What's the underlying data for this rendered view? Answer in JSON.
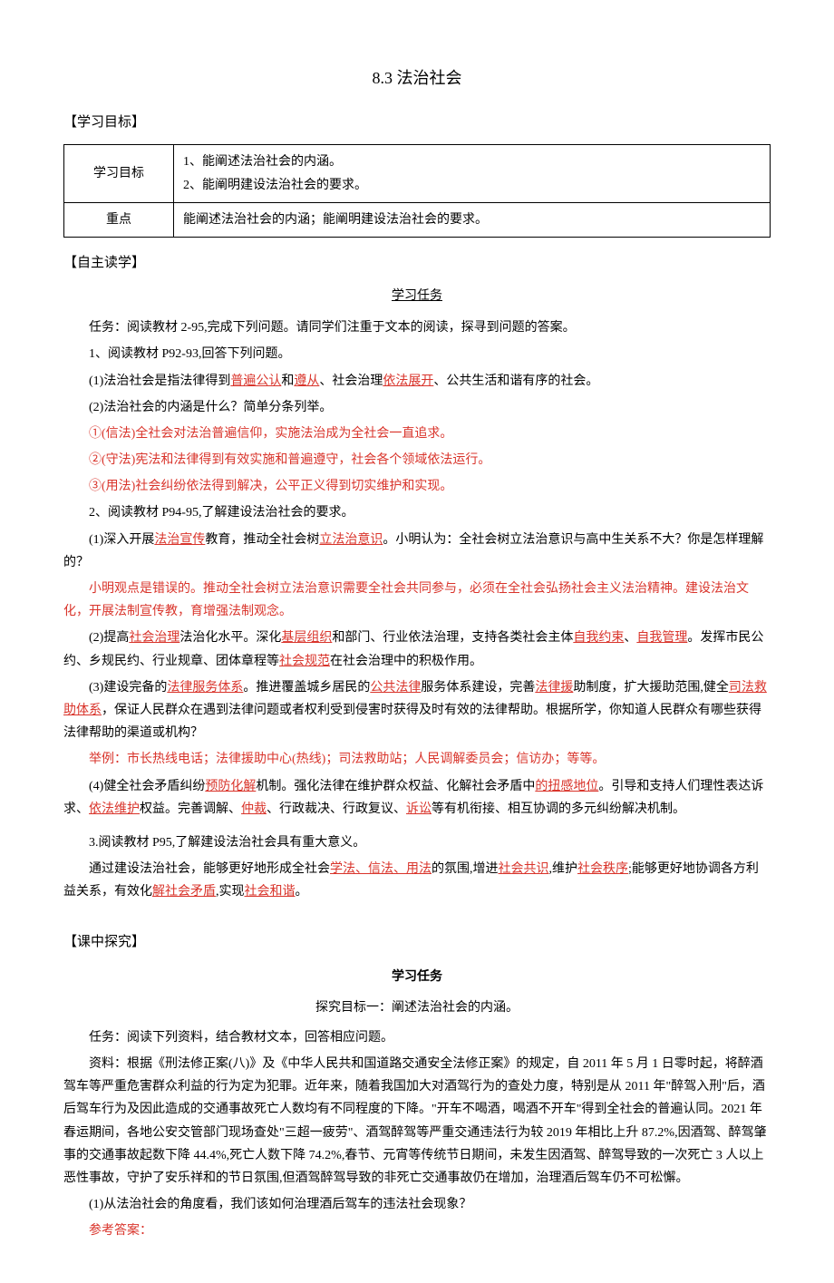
{
  "title": "8.3 法治社会",
  "sections": {
    "goals_heading": "【学习目标】",
    "self_study_heading": "【自主读学】",
    "explore_heading": "【课中探究】"
  },
  "goals_table": {
    "r1c1": "学习目标",
    "r1c2a": "1、能阐述法治社会的内涵。",
    "r1c2b": "2、能阐明建设法治社会的要求。",
    "r2c1": "重点",
    "r2c2": "能阐述法治社会的内涵；能阐明建设法治社会的要求。"
  },
  "study": {
    "task_heading": "学习任务",
    "task_line": "任务：阅读教材 2-95,完成下列问题。请同学们注重于文本的阅读，探寻到问题的答案。",
    "q1_intro": "1、阅读教材 P92-93,回答下列问题。",
    "q1_1_pre": "(1)法治社会是指法律得到",
    "q1_1_u1": "普遍公认",
    "q1_1_mid1": "和",
    "q1_1_u2": "遵从",
    "q1_1_mid2": "、社会治理",
    "q1_1_u3": "依法展开",
    "q1_1_post": "、公共生活和谐有序的社会。",
    "q1_2": "(2)法治社会的内涵是什么？简单分条列举。",
    "ans1": "①(信法)全社会对法治普遍信仰，实施法治成为全社会一直追求。",
    "ans2": "②(守法)宪法和法律得到有效实施和普遍遵守，社会各个领域依法运行。",
    "ans3": "③(用法)社会纠纷依法得到解决，公平正义得到切实维护和实现。",
    "q2_intro": "2、阅读教材 P94-95,了解建设法治社会的要求。",
    "q2_1_pre": "(1)深入开展",
    "q2_1_u1": "法治宣传",
    "q2_1_mid1": "教育，推动全社会树",
    "q2_1_u2": "立法治意识",
    "q2_1_post": "。小明认为：全社会树立法治意识与高中生关系不大？你是怎样理解的？",
    "q2_1_ans": "小明观点是错误的。推动全社会树立法治意识需要全社会共同参与，必须在全社会弘扬社会主义法治精神。建设法治文化，开展法制宣传教，育增强法制观念。",
    "q2_2_pre": "(2)提高",
    "q2_2_u1": "社会治理",
    "q2_2_mid1": "法治化水平。深化",
    "q2_2_u2": "基层组织",
    "q2_2_mid2": "和部门、行业依法治理，支持各类社会主体",
    "q2_2_u3": "自我约束",
    "q2_2_mid3": "、",
    "q2_2_u4": "自我管理",
    "q2_2_mid4": "。发挥市民公约、乡规民约、行业规章、团体章程等",
    "q2_2_u5": "社会规范",
    "q2_2_post": "在社会治理中的积极作用。",
    "q2_3_pre": "(3)建设完备的",
    "q2_3_u1": "法律服务体系",
    "q2_3_mid1": "。推进覆盖城乡居民的",
    "q2_3_u2": "公共法律",
    "q2_3_mid2": "服务体系建设，完善",
    "q2_3_u3": "法律援",
    "q2_3_mid3": "助制度，扩大援助范围,健全",
    "q2_3_u4": "司法救助体系",
    "q2_3_post": "，保证人民群众在遇到法律问题或者权利受到侵害时获得及时有效的法律帮助。根据所学，你知道人民群众有哪些获得法律帮助的渠道或机构？",
    "q2_3_ans": "举例：市长热线电话；法律援助中心(热线)；司法救助站；人民调解委员会；信访办；等等。",
    "q2_4_pre": "(4)健全社会矛盾纠纷",
    "q2_4_u1": "预防化解",
    "q2_4_mid1": "机制。强化法律在维护群众权益、化解社会矛盾中",
    "q2_4_u2": "的扭感地位",
    "q2_4_mid2": "。引导和支持人们理性表达诉求、",
    "q2_4_u3": "依法维护",
    "q2_4_mid3": "权益。完善调解、",
    "q2_4_u4": "仲裁",
    "q2_4_mid4": "、行政裁决、行政复议、",
    "q2_4_u5": "诉讼",
    "q2_4_post": "等有机衔接、相互协调的多元纠纷解决机制。",
    "q3_intro": "3.阅读教材 P95,了解建设法治社会具有重大意义。",
    "q3_pre": "通过建设法治社会，能够更好地形成全社会",
    "q3_u1": "学法、信法、用法",
    "q3_mid1": "的氛围,增进",
    "q3_u2": "社会共识",
    "q3_mid2": ",维护",
    "q3_u3": "社会秩序",
    "q3_mid3": ";能够更好地协调各方利益关系，有效化",
    "q3_u4": "解社会矛盾",
    "q3_mid4": ",实现",
    "q3_u5": "社会和谐",
    "q3_post": "。"
  },
  "explore": {
    "task_heading": "学习任务",
    "target1": "探究目标一：阐述法治社会的内涵。",
    "task_intro": "任务：阅读下列资料，结合教材文本，回答相应问题。",
    "material": "资料：根据《刑法修正案(八)》及《中华人民共和国道路交通安全法修正案》的规定，自 2011 年 5 月 1 日零时起，将醉酒驾车等严重危害群众利益的行为定为犯罪。近年来，随着我国加大对酒驾行为的查处力度，特别是从 2011 年\"醉驾入刑\"后，酒后驾车行为及因此造成的交通事故死亡人数均有不同程度的下降。\"开车不喝酒，喝酒不开车\"得到全社会的普遍认同。2021 年春运期间，各地公安交管部门现场查处\"三超一疲劳\"、酒驾醉驾等严重交通违法行为较 2019 年相比上升 87.2%,因酒驾、醉驾肇事的交通事故起数下降 44.4%,死亡人数下降 74.2%,春节、元宵等传统节日期间，未发生因酒驾、醉驾导致的一次死亡 3 人以上恶性事故，守护了安乐祥和的节日氛围,但酒驾醉驾导致的非死亡交通事故仍在增加，治理酒后驾车仍不可松懈。",
    "q1": "(1)从法治社会的角度看，我们该如何治理酒后驾车的违法社会现象？",
    "ans_label": "参考答案："
  }
}
